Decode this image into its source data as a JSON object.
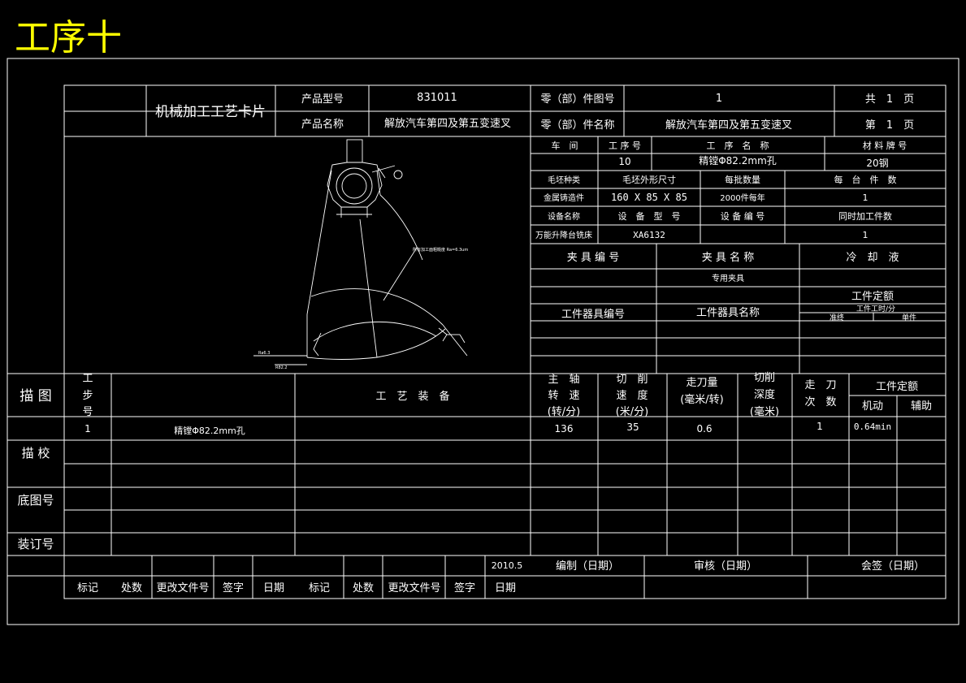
{
  "page_title": "工序十",
  "colors": {
    "background": "#000000",
    "lines": "#ffffff",
    "title": "#ffff00"
  },
  "header": {
    "card_title": "机械加工工艺卡片",
    "product_model_label": "产品型号",
    "product_model_value": "831011",
    "product_name_label": "产品名称",
    "product_name_value": "解放汽车第四及第五变速叉",
    "part_drawing_no_label": "零（部）件图号",
    "part_drawing_no_value": "1",
    "part_name_label": "零（部）件名称",
    "part_name_value": "解放汽车第四及第五变速叉",
    "total_pages": "共　1　页",
    "page_no": "第　1　页"
  },
  "process_info": {
    "workshop_label": "车　间",
    "process_no_label": "工 序 号",
    "process_name_label": "工　序　名　称",
    "material_label": "材 料 牌 号",
    "process_no_value": "10",
    "process_name_value": "精镗Φ82.2mm孔",
    "material_value": "20钢",
    "blank_type_label": "毛坯种类",
    "blank_size_label": "毛坯外形尺寸",
    "batch_label": "每批数量",
    "per_unit_label": "每　台　件　数",
    "blank_type_value": "金属铸造件",
    "blank_size_value": "160 X 85 X 85",
    "batch_value": "2000件每年",
    "per_unit_value": "1",
    "equipment_name_label": "设备名称",
    "equipment_model_label": "设　备　型　号",
    "equipment_no_label": "设 备 编 号",
    "simultaneous_label": "同时加工件数",
    "equipment_name_value": "万能升降台铣床",
    "equipment_model_value": "XA6132",
    "simultaneous_value": "1"
  },
  "fixture": {
    "fixture_no_label": "夹 具 编 号",
    "fixture_name_label": "夹 具 名 称",
    "coolant_label": "冷　却　液",
    "fixture_name_value": "专用夹具",
    "quota_label": "工件定额",
    "tool_no_label": "工件器具编号",
    "tool_name_label": "工件器具名称",
    "unit_time_label": "工件工时/分",
    "prep_label": "准终",
    "single_label": "单件"
  },
  "drawing_notes": {
    "note1": "所有加工面粗糙度 Ra=6.3um",
    "note2": "Ra6.3",
    "note3": "R82.2"
  },
  "ops_header": {
    "trace_label": "描 图",
    "step_label_1": "工",
    "step_label_2": "步",
    "step_label_3": "号",
    "equipment_label": "工　艺　装　备",
    "spindle_1": "主　轴",
    "spindle_2": "转　速",
    "spindle_3": "(转/分)",
    "cut_speed_1": "切　削",
    "cut_speed_2": "速　度",
    "cut_speed_3": "(米/分)",
    "feed_1": "走刀量",
    "feed_2": "(毫米/转)",
    "depth_1": "切削",
    "depth_2": "深度",
    "depth_3": "(毫米)",
    "passes_1": "走　刀",
    "passes_2": "次　数",
    "quota_label": "工件定额",
    "machine_label": "机动",
    "aux_label": "辅助"
  },
  "ops_row": {
    "step": "1",
    "content": "精镗Φ82.2mm孔",
    "spindle": "136",
    "speed": "35",
    "feed": "0.6",
    "passes": "1",
    "machine_time": "0.64min"
  },
  "side_labels": {
    "check": "描 校",
    "base_no": "底图号",
    "binding_no": "装订号"
  },
  "footer": {
    "date_value": "2010.5",
    "compiled": "编制（日期）",
    "reviewed": "审核（日期）",
    "countersign": "会签（日期）",
    "mark1": "标记",
    "count1": "处数",
    "doc1": "更改文件号",
    "sign1": "签字",
    "date1": "日期",
    "mark2": "标记",
    "count2": "处数",
    "doc2": "更改文件号",
    "sign2": "签字",
    "date2": "日期"
  }
}
